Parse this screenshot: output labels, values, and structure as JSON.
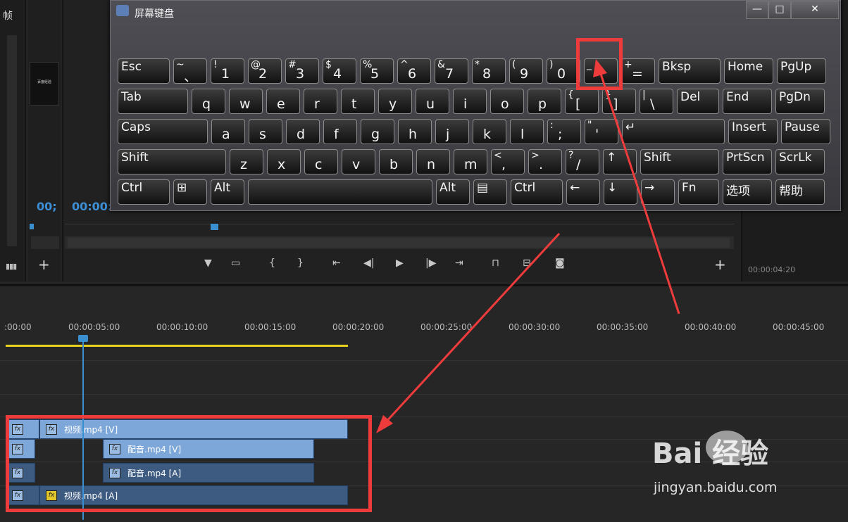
{
  "left_panel": {
    "tab_label": "帧",
    "icon": "list-view-icon"
  },
  "source_monitor": {
    "timecode": "00;",
    "thumb_text": "百度经验"
  },
  "program_monitor": {
    "timecode": "00:00:",
    "transport_icons": [
      "marker-icon",
      "safe-margin-icon",
      "mark-in-icon",
      "mark-out-icon",
      "go-to-in-icon",
      "step-back-icon",
      "play-icon",
      "step-forward-icon",
      "go-to-out-icon",
      "lift-icon",
      "extract-icon",
      "camera-icon"
    ],
    "add_button": "+"
  },
  "right_panel": {
    "timecode": "00:00:04:20"
  },
  "osk": {
    "title": "屏幕键盘",
    "minimize": "—",
    "maximize": "□",
    "close": "✕",
    "rows": [
      [
        {
          "t": "Esc"
        },
        {
          "t": "~",
          "b": "、"
        },
        {
          "t": "!",
          "b": "1"
        },
        {
          "t": "@",
          "b": "2"
        },
        {
          "t": "#",
          "b": "3"
        },
        {
          "t": "$",
          "b": "4"
        },
        {
          "t": "%",
          "b": "5"
        },
        {
          "t": "^",
          "b": "6"
        },
        {
          "t": "&",
          "b": "7"
        },
        {
          "t": "*",
          "b": "8"
        },
        {
          "t": "(",
          "b": "9"
        },
        {
          "t": ")",
          "b": "0"
        },
        {
          "t": "_",
          "b": "-"
        },
        {
          "t": "+",
          "b": "="
        },
        {
          "t": "Bksp"
        },
        {
          "t": "Home"
        },
        {
          "t": "PgUp"
        }
      ],
      [
        {
          "t": "Tab"
        },
        {
          "b": "q"
        },
        {
          "b": "w"
        },
        {
          "b": "e"
        },
        {
          "b": "r"
        },
        {
          "b": "t"
        },
        {
          "b": "y"
        },
        {
          "b": "u"
        },
        {
          "b": "i"
        },
        {
          "b": "o"
        },
        {
          "b": "p"
        },
        {
          "t": "{",
          "b": "["
        },
        {
          "t": "}",
          "b": "]"
        },
        {
          "t": "|",
          "b": "\\"
        },
        {
          "t": "Del"
        },
        {
          "t": "End"
        },
        {
          "t": "PgDn"
        }
      ],
      [
        {
          "t": "Caps"
        },
        {
          "b": "a"
        },
        {
          "b": "s"
        },
        {
          "b": "d"
        },
        {
          "b": "f"
        },
        {
          "b": "g"
        },
        {
          "b": "h"
        },
        {
          "b": "j"
        },
        {
          "b": "k"
        },
        {
          "b": "l"
        },
        {
          "t": ":",
          "b": ";"
        },
        {
          "t": "\"",
          "b": "'"
        },
        {
          "t": "↵"
        },
        {
          "t": "Insert"
        },
        {
          "t": "Pause"
        }
      ],
      [
        {
          "t": "Shift"
        },
        {
          "b": "z"
        },
        {
          "b": "x"
        },
        {
          "b": "c"
        },
        {
          "b": "v"
        },
        {
          "b": "b"
        },
        {
          "b": "n"
        },
        {
          "b": "m"
        },
        {
          "t": "<",
          "b": ","
        },
        {
          "t": ">",
          "b": "."
        },
        {
          "t": "?",
          "b": "/"
        },
        {
          "t": "↑"
        },
        {
          "t": "Shift"
        },
        {
          "t": "PrtScn"
        },
        {
          "t": "ScrLk"
        }
      ],
      [
        {
          "t": "Ctrl"
        },
        {
          "t": "⊞"
        },
        {
          "t": "Alt"
        },
        {
          "t": ""
        },
        {
          "t": "Alt"
        },
        {
          "t": "▤"
        },
        {
          "t": "Ctrl"
        },
        {
          "t": "←"
        },
        {
          "t": "↓"
        },
        {
          "t": "→"
        },
        {
          "t": "Fn"
        },
        {
          "t": "选项"
        },
        {
          "t": "帮助"
        }
      ]
    ]
  },
  "timeline": {
    "ticks": [
      ":00:00",
      "00:00:05:00",
      "00:00:10:00",
      "00:00:15:00",
      "00:00:20:00",
      "00:00:25:00",
      "00:00:30:00",
      "00:00:35:00",
      "00:00:40:00",
      "00:00:45:00"
    ],
    "fx_label": "fx",
    "clips": [
      {
        "name": "视频.mp4 [V]",
        "kind": "v"
      },
      {
        "name": "配音.mp4 [V]",
        "kind": "v"
      },
      {
        "name": "配音.mp4 [A]",
        "kind": "a"
      },
      {
        "name": "视频.mp4 [A]",
        "kind": "a"
      }
    ]
  },
  "watermark": {
    "brand": "Bai 经验",
    "url": "jingyan.baidu.com"
  },
  "colors": {
    "accent": "#3c8fd6",
    "highlight": "#ee3b3b",
    "work_area": "#e6d21e"
  }
}
